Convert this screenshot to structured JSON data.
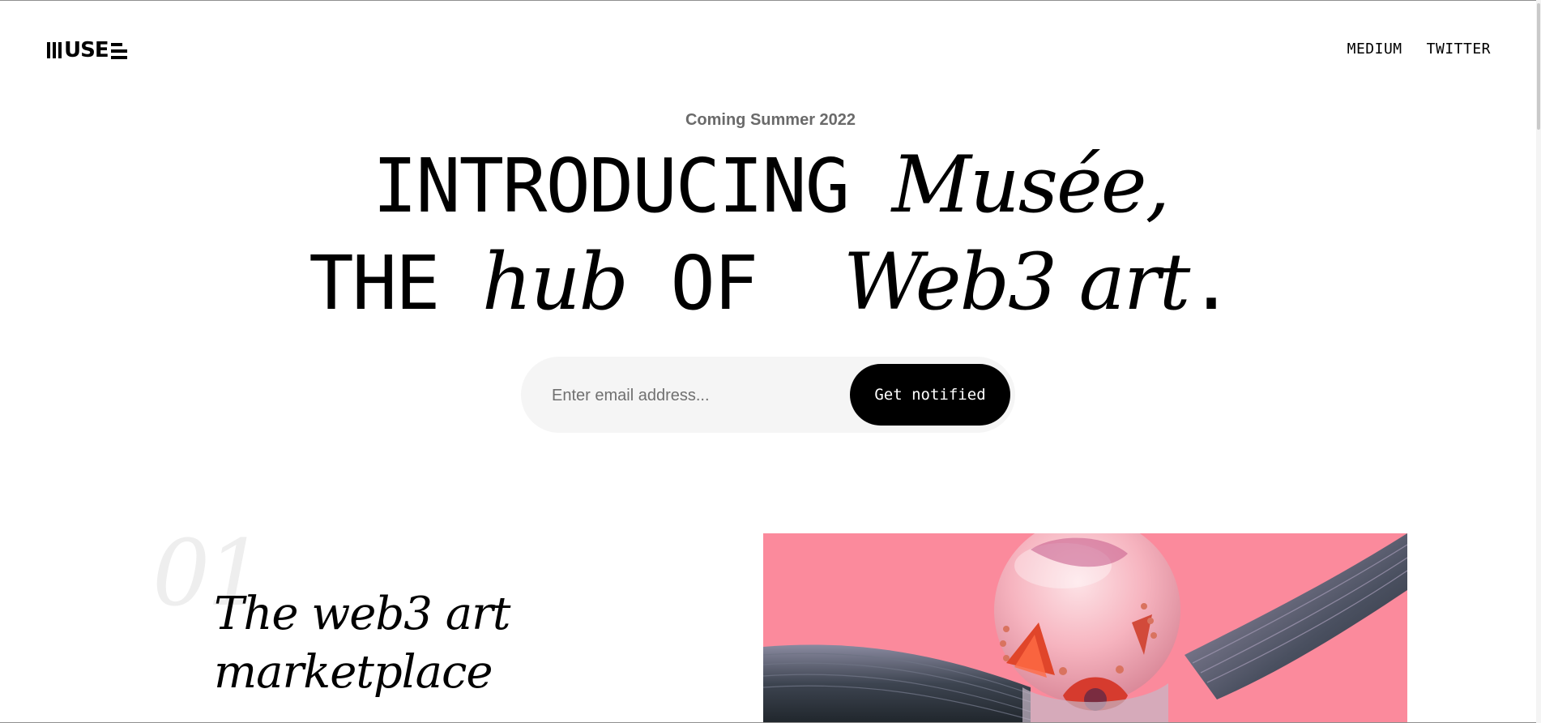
{
  "header": {
    "logo_text": "USE",
    "logo_label": "MUSEE",
    "nav": [
      "MEDIUM",
      "TWITTER"
    ]
  },
  "hero": {
    "tagline": "Coming Summer 2022",
    "line1": {
      "mono": "INTRODUCING ",
      "serif": "Musée",
      "mono_end": ","
    },
    "line2": {
      "mono1": "THE ",
      "serif1": "hub",
      "mono2": " OF  ",
      "serif2": "Web3 art",
      "mono3": "."
    }
  },
  "signup": {
    "placeholder": "Enter email address...",
    "value": "",
    "button_label": "Get notified"
  },
  "section": {
    "number": "01",
    "title_line1": "The web3 art",
    "title_line2": "marketplace"
  },
  "colors": {
    "artwork_background": "#fb8a9c",
    "button": "#000000",
    "input_background": "#f5f5f5",
    "tagline": "#6a6a6a"
  },
  "icons": [
    "logo-mark"
  ]
}
